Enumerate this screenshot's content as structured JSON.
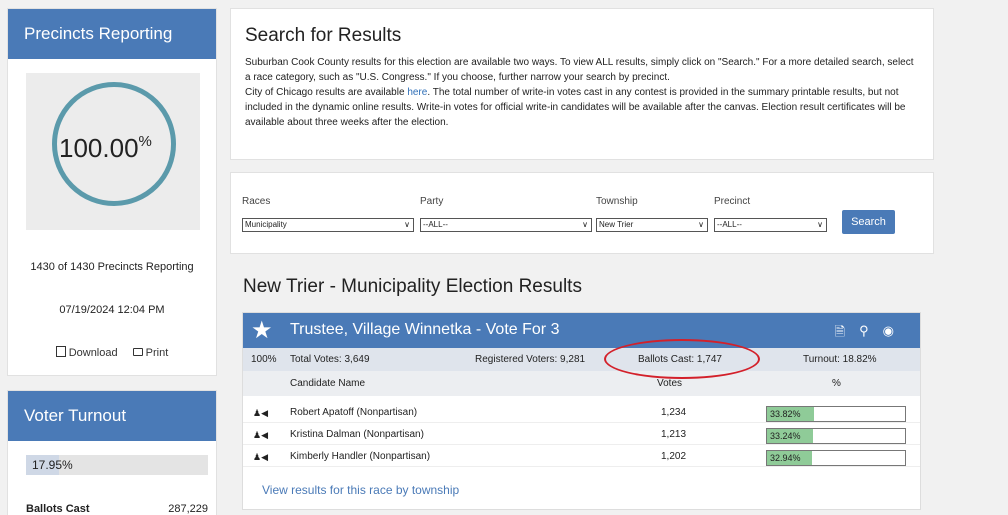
{
  "precincts": {
    "title": "Precincts Reporting",
    "percent": "100.00",
    "percent_sign": "%",
    "summary": "1430 of 1430 Precincts Reporting",
    "timestamp": "07/19/2024 12:04 PM",
    "download_label": "Download",
    "print_label": "Print"
  },
  "turnout": {
    "title": "Voter Turnout",
    "percent": "17.95%",
    "fill_fraction": 0.18,
    "ballots_label": "Ballots Cast",
    "ballots_value": "287,229"
  },
  "search": {
    "title": "Search for Results",
    "intro_1": "Suburban Cook County results for this election are available two ways. To view ALL results, simply click on \"Search.\" For a more detailed search, select a race category, such as \"U.S. Congress.\" If you choose, further narrow your search by precinct.",
    "intro_2a": "City of Chicago results are available ",
    "intro_link": "here",
    "intro_2b": ". The total number of write-in votes cast in any contest is provided in the summary printable results, but not included in the dynamic online results. Write-in votes for official write-in candidates will be available after the canvas. Election result certificates will be available about three weeks after the election."
  },
  "filters": {
    "races_label": "Races",
    "races_value": "Municipality",
    "party_label": "Party",
    "party_value": "--ALL--",
    "township_label": "Township",
    "township_value": "New Trier",
    "precinct_label": "Precinct",
    "precinct_value": "--ALL--",
    "search_button": "Search"
  },
  "results": {
    "title": "New Trier - Municipality Election Results",
    "race_name": "Trustee, Village Winnetka - Vote For 3",
    "reporting": "100%",
    "total_votes": "Total Votes: 3,649",
    "registered_voters": "Registered Voters: 9,281",
    "ballots_cast": "Ballots Cast: 1,747",
    "turnout": "Turnout: 18.82%",
    "col_candidate": "Candidate Name",
    "col_votes": "Votes",
    "col_percent": "%",
    "candidates": [
      {
        "name": "Robert Apatoff (Nonpartisan)",
        "votes": "1,234",
        "percent": "33.82%",
        "fraction": 0.3382
      },
      {
        "name": "Kristina Dalman (Nonpartisan)",
        "votes": "1,213",
        "percent": "33.24%",
        "fraction": 0.3324
      },
      {
        "name": "Kimberly Handler (Nonpartisan)",
        "votes": "1,202",
        "percent": "32.94%",
        "fraction": 0.3294
      }
    ],
    "view_by_township": "View results for this race by township"
  },
  "colors": {
    "header_blue": "#4a7ab7",
    "gauge_ring": "#5b9aab",
    "bar_green": "#8fcb98",
    "highlight_red": "#d3202a"
  }
}
